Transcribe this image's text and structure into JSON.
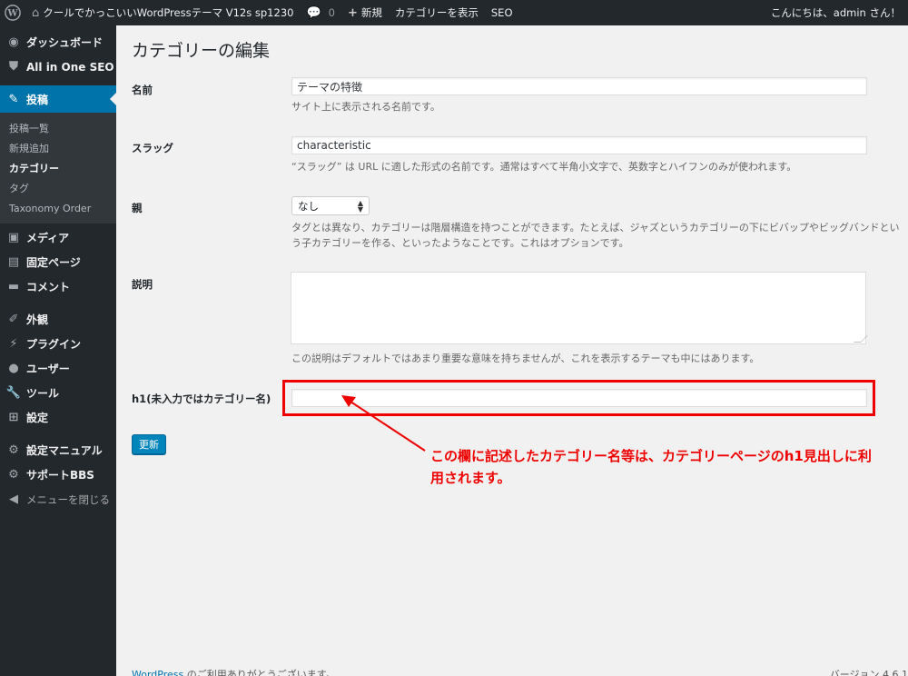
{
  "adminbar": {
    "site_name": "クールでかっこいいWordPressテーマ V12s sp1230",
    "comments_count": "0",
    "new_label": "新規",
    "view_category": "カテゴリーを表示",
    "seo": "SEO",
    "greeting": "こんにちは、admin さん！"
  },
  "sidebar": {
    "dashboard": "ダッシュボード",
    "seo_plugin": "All in One SEO",
    "posts": "投稿",
    "sub": [
      "投稿一覧",
      "新規追加",
      "カテゴリー",
      "タグ",
      "Taxonomy Order"
    ],
    "media": "メディア",
    "pages": "固定ページ",
    "comments": "コメント",
    "appearance": "外観",
    "plugins": "プラグイン",
    "users": "ユーザー",
    "tools": "ツール",
    "settings": "設定",
    "manual": "設定マニュアル",
    "support": "サポートBBS",
    "collapse": "メニューを閉じる"
  },
  "page": {
    "title": "カテゴリーの編集",
    "name_label": "名前",
    "name_value": "テーマの特徴",
    "name_desc": "サイト上に表示される名前です。",
    "slug_label": "スラッグ",
    "slug_value": "characteristic",
    "slug_desc": "“スラッグ” は URL に適した形式の名前です。通常はすべて半角小文字で、英数字とハイフンのみが使われます。",
    "parent_label": "親",
    "parent_value": "なし",
    "parent_desc": "タグとは異なり、カテゴリーは階層構造を持つことができます。たとえば、ジャズというカテゴリーの下にビバップやビッグバンドという子カテゴリーを作る、といったようなことです。これはオプションです。",
    "description_label": "説明",
    "description_value": "",
    "description_desc": "この説明はデフォルトではあまり重要な意味を持ちませんが、これを表示するテーマも中にはあります。",
    "h1_label": "h1(未入力ではカテゴリー名)",
    "h1_value": "",
    "update_button": "更新",
    "annotation": "この欄に記述したカテゴリー名等は、カテゴリーページのh1見出しに利用されます。"
  },
  "footer": {
    "wp_link": "WordPress",
    "thanks": " のご利用ありがとうございます。",
    "version": "バージョン 4.6.1"
  },
  "colors": {
    "accent": "#0073aa",
    "highlight": "#ee0000"
  }
}
